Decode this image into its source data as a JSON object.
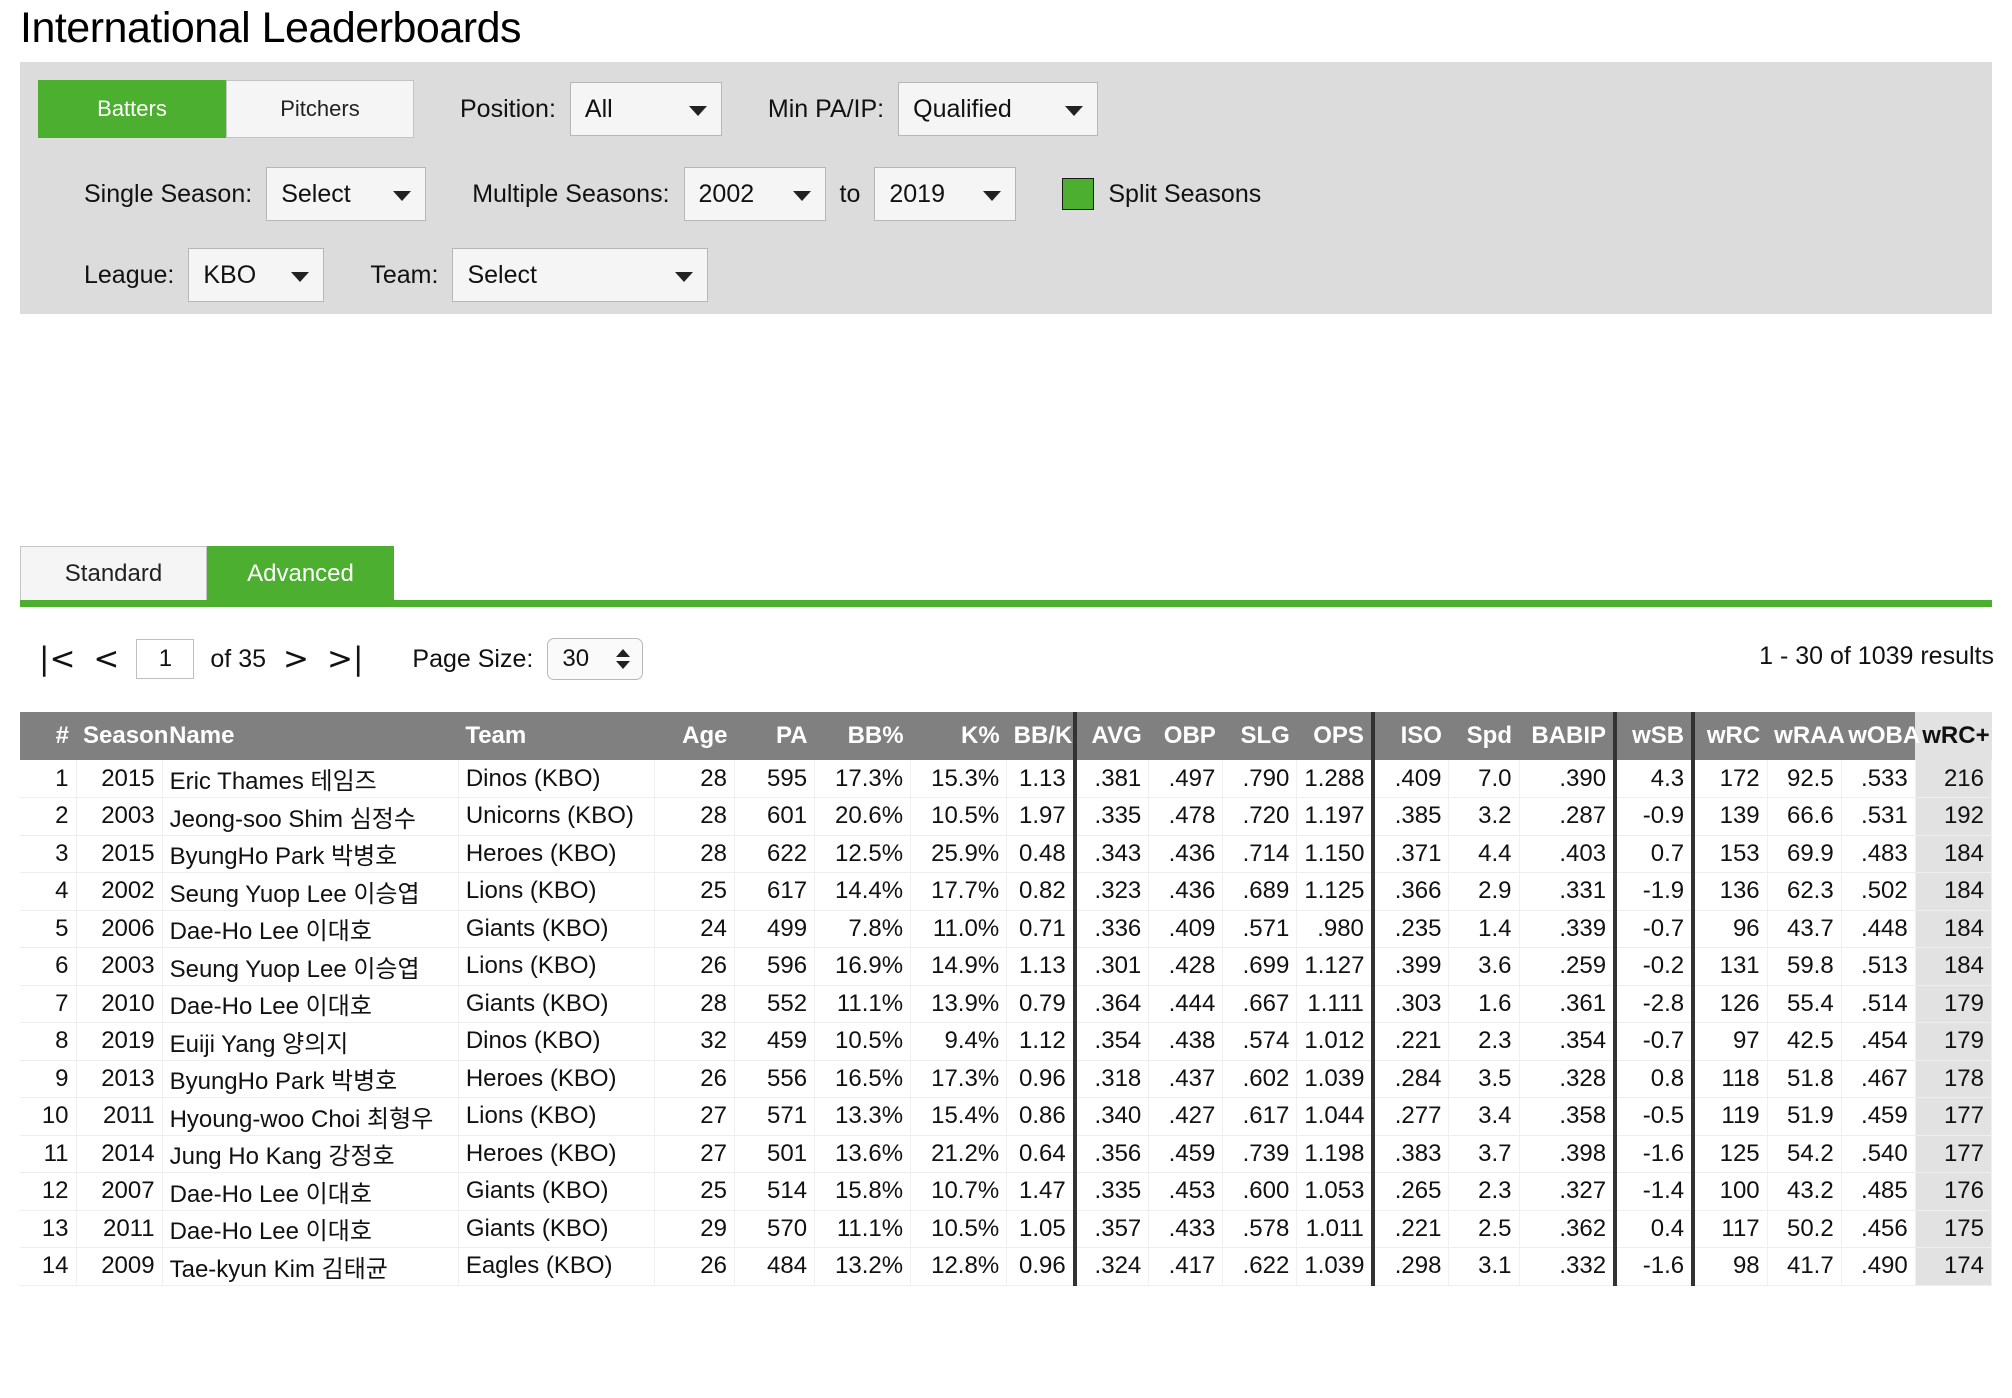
{
  "page": {
    "title": "International Leaderboards"
  },
  "filters": {
    "batters_label": "Batters",
    "pitchers_label": "Pitchers",
    "position_label": "Position:",
    "position_value": "All",
    "min_pa_ip_label": "Min PA/IP:",
    "min_pa_ip_value": "Qualified",
    "single_season_label": "Single Season:",
    "single_season_value": "Select",
    "multiple_seasons_label": "Multiple Seasons:",
    "season_from": "2002",
    "season_to_label": "to",
    "season_to": "2019",
    "split_seasons_label": "Split Seasons",
    "league_label": "League:",
    "league_value": "KBO",
    "team_label": "Team:",
    "team_value": "Select",
    "accent_color": "#4caf2f"
  },
  "view_tabs": {
    "standard": "Standard",
    "advanced": "Advanced",
    "active": "Advanced"
  },
  "pager": {
    "first_icon": "|<",
    "prev_icon": "<",
    "page_value": "1",
    "of_text": "of 35",
    "next_icon": ">",
    "last_icon": ">|",
    "page_size_label": "Page Size:",
    "page_size_value": "30",
    "results_text": "1 - 30 of 1039 results"
  },
  "table": {
    "sorted_column": "wRC+",
    "columns": [
      {
        "key": "rank",
        "label": "#",
        "align": "right",
        "sep": false
      },
      {
        "key": "season",
        "label": "Season",
        "align": "right",
        "sep": false
      },
      {
        "key": "name",
        "label": "Name",
        "align": "left",
        "sep": false
      },
      {
        "key": "team",
        "label": "Team",
        "align": "left",
        "sep": false
      },
      {
        "key": "age",
        "label": "Age",
        "align": "right",
        "sep": false
      },
      {
        "key": "pa",
        "label": "PA",
        "align": "right",
        "sep": false
      },
      {
        "key": "bb",
        "label": "BB%",
        "align": "right",
        "sep": false
      },
      {
        "key": "k",
        "label": "K%",
        "align": "right",
        "sep": false
      },
      {
        "key": "bbk",
        "label": "BB/K",
        "align": "right",
        "sep": false
      },
      {
        "key": "avg",
        "label": "AVG",
        "align": "right",
        "sep": true
      },
      {
        "key": "obp",
        "label": "OBP",
        "align": "right",
        "sep": false
      },
      {
        "key": "slg",
        "label": "SLG",
        "align": "right",
        "sep": false
      },
      {
        "key": "ops",
        "label": "OPS",
        "align": "right",
        "sep": false
      },
      {
        "key": "iso",
        "label": "ISO",
        "align": "right",
        "sep": true
      },
      {
        "key": "spd",
        "label": "Spd",
        "align": "right",
        "sep": false
      },
      {
        "key": "babip",
        "label": "BABIP",
        "align": "right",
        "sep": false
      },
      {
        "key": "wsb",
        "label": "wSB",
        "align": "right",
        "sep": true
      },
      {
        "key": "wrc",
        "label": "wRC",
        "align": "right",
        "sep": true
      },
      {
        "key": "wraa",
        "label": "wRAA",
        "align": "right",
        "sep": false
      },
      {
        "key": "woba",
        "label": "wOBA",
        "align": "right",
        "sep": false
      },
      {
        "key": "wrcp",
        "label": "wRC+",
        "align": "right",
        "sep": false
      }
    ],
    "rows": [
      {
        "rank": "1",
        "season": "2015",
        "name": "Eric Thames 테임즈",
        "team": "Dinos (KBO)",
        "age": "28",
        "pa": "595",
        "bb": "17.3%",
        "k": "15.3%",
        "bbk": "1.13",
        "avg": ".381",
        "obp": ".497",
        "slg": ".790",
        "ops": "1.288",
        "iso": ".409",
        "spd": "7.0",
        "babip": ".390",
        "wsb": "4.3",
        "wrc": "172",
        "wraa": "92.5",
        "woba": ".533",
        "wrcp": "216"
      },
      {
        "rank": "2",
        "season": "2003",
        "name": "Jeong-soo Shim 심정수",
        "team": "Unicorns (KBO)",
        "age": "28",
        "pa": "601",
        "bb": "20.6%",
        "k": "10.5%",
        "bbk": "1.97",
        "avg": ".335",
        "obp": ".478",
        "slg": ".720",
        "ops": "1.197",
        "iso": ".385",
        "spd": "3.2",
        "babip": ".287",
        "wsb": "-0.9",
        "wrc": "139",
        "wraa": "66.6",
        "woba": ".531",
        "wrcp": "192"
      },
      {
        "rank": "3",
        "season": "2015",
        "name": "ByungHo Park 박병호",
        "team": "Heroes (KBO)",
        "age": "28",
        "pa": "622",
        "bb": "12.5%",
        "k": "25.9%",
        "bbk": "0.48",
        "avg": ".343",
        "obp": ".436",
        "slg": ".714",
        "ops": "1.150",
        "iso": ".371",
        "spd": "4.4",
        "babip": ".403",
        "wsb": "0.7",
        "wrc": "153",
        "wraa": "69.9",
        "woba": ".483",
        "wrcp": "184"
      },
      {
        "rank": "4",
        "season": "2002",
        "name": "Seung Yuop Lee 이승엽",
        "team": "Lions (KBO)",
        "age": "25",
        "pa": "617",
        "bb": "14.4%",
        "k": "17.7%",
        "bbk": "0.82",
        "avg": ".323",
        "obp": ".436",
        "slg": ".689",
        "ops": "1.125",
        "iso": ".366",
        "spd": "2.9",
        "babip": ".331",
        "wsb": "-1.9",
        "wrc": "136",
        "wraa": "62.3",
        "woba": ".502",
        "wrcp": "184"
      },
      {
        "rank": "5",
        "season": "2006",
        "name": "Dae-Ho Lee 이대호",
        "team": "Giants (KBO)",
        "age": "24",
        "pa": "499",
        "bb": "7.8%",
        "k": "11.0%",
        "bbk": "0.71",
        "avg": ".336",
        "obp": ".409",
        "slg": ".571",
        "ops": ".980",
        "iso": ".235",
        "spd": "1.4",
        "babip": ".339",
        "wsb": "-0.7",
        "wrc": "96",
        "wraa": "43.7",
        "woba": ".448",
        "wrcp": "184"
      },
      {
        "rank": "6",
        "season": "2003",
        "name": "Seung Yuop Lee 이승엽",
        "team": "Lions (KBO)",
        "age": "26",
        "pa": "596",
        "bb": "16.9%",
        "k": "14.9%",
        "bbk": "1.13",
        "avg": ".301",
        "obp": ".428",
        "slg": ".699",
        "ops": "1.127",
        "iso": ".399",
        "spd": "3.6",
        "babip": ".259",
        "wsb": "-0.2",
        "wrc": "131",
        "wraa": "59.8",
        "woba": ".513",
        "wrcp": "184"
      },
      {
        "rank": "7",
        "season": "2010",
        "name": "Dae-Ho Lee 이대호",
        "team": "Giants (KBO)",
        "age": "28",
        "pa": "552",
        "bb": "11.1%",
        "k": "13.9%",
        "bbk": "0.79",
        "avg": ".364",
        "obp": ".444",
        "slg": ".667",
        "ops": "1.111",
        "iso": ".303",
        "spd": "1.6",
        "babip": ".361",
        "wsb": "-2.8",
        "wrc": "126",
        "wraa": "55.4",
        "woba": ".514",
        "wrcp": "179"
      },
      {
        "rank": "8",
        "season": "2019",
        "name": "Euiji Yang 양의지",
        "team": "Dinos (KBO)",
        "age": "32",
        "pa": "459",
        "bb": "10.5%",
        "k": "9.4%",
        "bbk": "1.12",
        "avg": ".354",
        "obp": ".438",
        "slg": ".574",
        "ops": "1.012",
        "iso": ".221",
        "spd": "2.3",
        "babip": ".354",
        "wsb": "-0.7",
        "wrc": "97",
        "wraa": "42.5",
        "woba": ".454",
        "wrcp": "179"
      },
      {
        "rank": "9",
        "season": "2013",
        "name": "ByungHo Park 박병호",
        "team": "Heroes (KBO)",
        "age": "26",
        "pa": "556",
        "bb": "16.5%",
        "k": "17.3%",
        "bbk": "0.96",
        "avg": ".318",
        "obp": ".437",
        "slg": ".602",
        "ops": "1.039",
        "iso": ".284",
        "spd": "3.5",
        "babip": ".328",
        "wsb": "0.8",
        "wrc": "118",
        "wraa": "51.8",
        "woba": ".467",
        "wrcp": "178"
      },
      {
        "rank": "10",
        "season": "2011",
        "name": "Hyoung-woo Choi 최형우",
        "team": "Lions (KBO)",
        "age": "27",
        "pa": "571",
        "bb": "13.3%",
        "k": "15.4%",
        "bbk": "0.86",
        "avg": ".340",
        "obp": ".427",
        "slg": ".617",
        "ops": "1.044",
        "iso": ".277",
        "spd": "3.4",
        "babip": ".358",
        "wsb": "-0.5",
        "wrc": "119",
        "wraa": "51.9",
        "woba": ".459",
        "wrcp": "177"
      },
      {
        "rank": "11",
        "season": "2014",
        "name": "Jung Ho Kang 강정호",
        "team": "Heroes (KBO)",
        "age": "27",
        "pa": "501",
        "bb": "13.6%",
        "k": "21.2%",
        "bbk": "0.64",
        "avg": ".356",
        "obp": ".459",
        "slg": ".739",
        "ops": "1.198",
        "iso": ".383",
        "spd": "3.7",
        "babip": ".398",
        "wsb": "-1.6",
        "wrc": "125",
        "wraa": "54.2",
        "woba": ".540",
        "wrcp": "177"
      },
      {
        "rank": "12",
        "season": "2007",
        "name": "Dae-Ho Lee 이대호",
        "team": "Giants (KBO)",
        "age": "25",
        "pa": "514",
        "bb": "15.8%",
        "k": "10.7%",
        "bbk": "1.47",
        "avg": ".335",
        "obp": ".453",
        "slg": ".600",
        "ops": "1.053",
        "iso": ".265",
        "spd": "2.3",
        "babip": ".327",
        "wsb": "-1.4",
        "wrc": "100",
        "wraa": "43.2",
        "woba": ".485",
        "wrcp": "176"
      },
      {
        "rank": "13",
        "season": "2011",
        "name": "Dae-Ho Lee 이대호",
        "team": "Giants (KBO)",
        "age": "29",
        "pa": "570",
        "bb": "11.1%",
        "k": "10.5%",
        "bbk": "1.05",
        "avg": ".357",
        "obp": ".433",
        "slg": ".578",
        "ops": "1.011",
        "iso": ".221",
        "spd": "2.5",
        "babip": ".362",
        "wsb": "0.4",
        "wrc": "117",
        "wraa": "50.2",
        "woba": ".456",
        "wrcp": "175"
      },
      {
        "rank": "14",
        "season": "2009",
        "name": "Tae-kyun Kim 김태균",
        "team": "Eagles (KBO)",
        "age": "26",
        "pa": "484",
        "bb": "13.2%",
        "k": "12.8%",
        "bbk": "0.96",
        "avg": ".324",
        "obp": ".417",
        "slg": ".622",
        "ops": "1.039",
        "iso": ".298",
        "spd": "3.1",
        "babip": ".332",
        "wsb": "-1.6",
        "wrc": "98",
        "wraa": "41.7",
        "woba": ".490",
        "wrcp": "174"
      }
    ]
  }
}
